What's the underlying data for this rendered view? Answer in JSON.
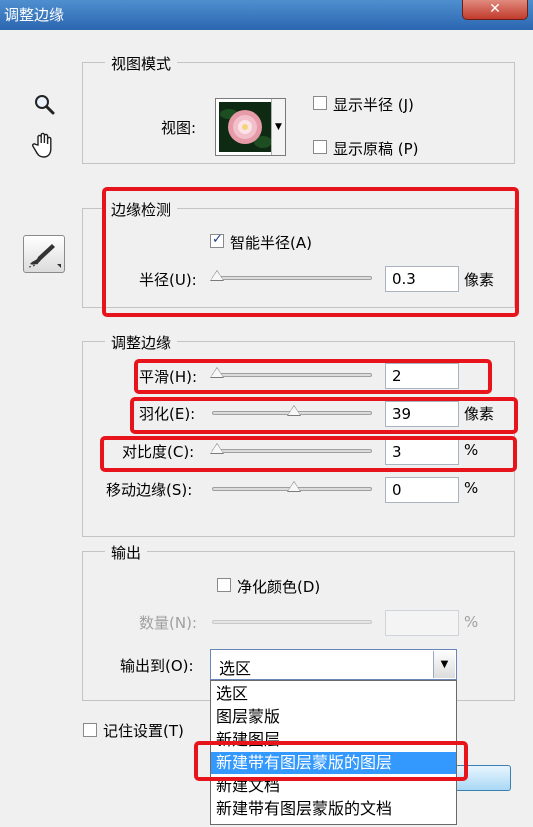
{
  "window": {
    "title": "调整边缘",
    "close_glyph": "✕"
  },
  "tools": {
    "zoom": "zoom-icon",
    "hand": "hand-icon",
    "brush": "refine-brush-icon"
  },
  "view_mode": {
    "legend": "视图模式",
    "view_label": "视图:",
    "show_radius": {
      "label": "显示半径 (J)",
      "checked": false
    },
    "show_original": {
      "label": "显示原稿 (P)",
      "checked": false
    }
  },
  "edge_detection": {
    "legend": "边缘检测",
    "smart_radius": {
      "label": "智能半径(A)",
      "checked": true
    },
    "radius": {
      "label": "半径(U):",
      "value": "0.3",
      "unit": "像素",
      "fraction": 0.0
    }
  },
  "adjust_edge": {
    "legend": "调整边缘",
    "smooth": {
      "label": "平滑(H):",
      "value": "2",
      "unit": "",
      "fraction": 0.0
    },
    "feather": {
      "label": "羽化(E):",
      "value": "39",
      "unit": "像素",
      "fraction": 0.5
    },
    "contrast": {
      "label": "对比度(C):",
      "value": "3",
      "unit": "%",
      "fraction": 0.0
    },
    "shift_edge": {
      "label": "移动边缘(S):",
      "value": "0",
      "unit": "%",
      "fraction": 0.5
    }
  },
  "output": {
    "legend": "输出",
    "decontaminate": {
      "label": "净化颜色(D)",
      "checked": false
    },
    "amount": {
      "label": "数量(N):",
      "value": "",
      "unit": "%"
    },
    "output_to_label": "输出到(O):",
    "output_to_value": "选区",
    "options": [
      "选区",
      "图层蒙版",
      "新建图层",
      "新建带有图层蒙版的图层",
      "新建文档",
      "新建带有图层蒙版的文档"
    ],
    "highlighted_index": 3
  },
  "remember": {
    "label": "记住设置(T)",
    "checked": false
  },
  "colors": {
    "highlight_red": "#e8141c",
    "selection_blue": "#3399ff"
  }
}
